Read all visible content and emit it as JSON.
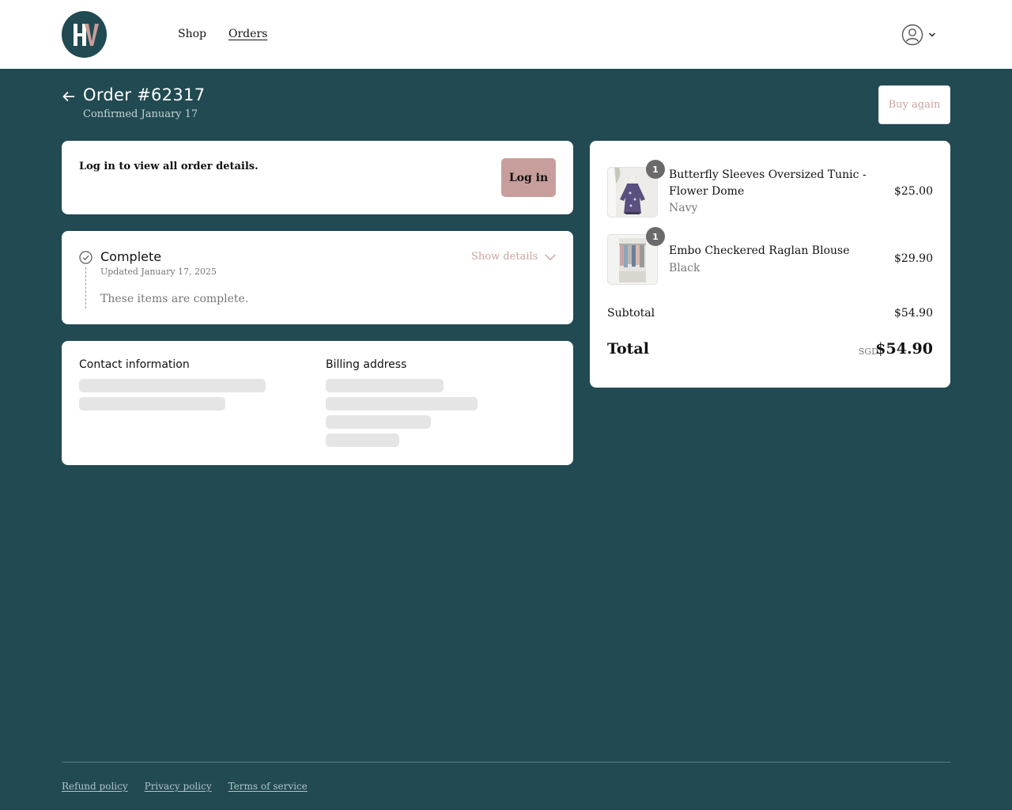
{
  "brand": {
    "logo_text": "HV",
    "colors": {
      "bg": "#214a52",
      "accent": "#c79e9b"
    }
  },
  "nav": {
    "items": [
      {
        "label": "Shop"
      },
      {
        "label": "Orders"
      }
    ]
  },
  "account": {
    "icon": "user-circle-icon",
    "dropdown_icon": "chevron-down-icon"
  },
  "order": {
    "title": "Order #62317",
    "subtitle": "Confirmed January 17",
    "buy_again_label": "Buy again"
  },
  "login": {
    "message": "Log in to view all order details.",
    "button_label": "Log in"
  },
  "status": {
    "title": "Complete",
    "updated": "Updated January 17, 2025",
    "description": "These items are complete.",
    "show_details_label": "Show details"
  },
  "info": {
    "contact_heading": "Contact information",
    "billing_heading": "Billing address"
  },
  "summary": {
    "items": [
      {
        "name": "Butterfly Sleeves Oversized Tunic - Flower Dome",
        "variant": "Navy",
        "price": "$25.00",
        "quantity": "1"
      },
      {
        "name": "Embo Checkered Raglan Blouse",
        "variant": "Black",
        "price": "$29.90",
        "quantity": "1"
      }
    ],
    "subtotal_label": "Subtotal",
    "subtotal_value": "$54.90",
    "total_label": "Total",
    "currency": "SGD",
    "total_value": "$54.90"
  },
  "footer": {
    "links": [
      {
        "label": "Refund policy"
      },
      {
        "label": "Privacy policy"
      },
      {
        "label": "Terms of service"
      }
    ]
  }
}
